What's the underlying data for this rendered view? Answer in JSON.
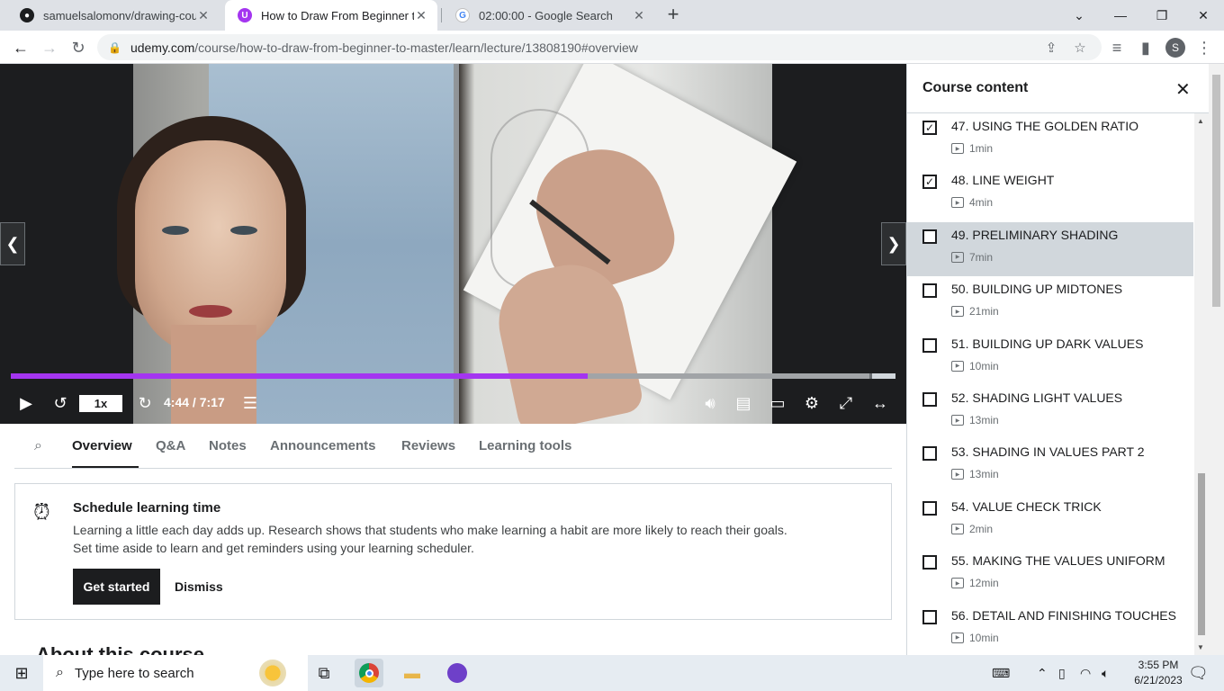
{
  "browser": {
    "tabs": [
      {
        "title": "samuelsalomonv/drawing-course",
        "icon": "github-icon"
      },
      {
        "title": "How to Draw From Beginner to M",
        "icon": "udemy-icon"
      },
      {
        "title": "02:00:00 - Google Search",
        "icon": "google-icon"
      }
    ],
    "url_host": "udemy.com",
    "url_path": "/course/how-to-draw-from-beginner-to-master/learn/lecture/13808190#overview",
    "profile_initial": "S"
  },
  "player": {
    "speed": "1x",
    "timecode": "4:44 / 7:17",
    "progress_fraction": 0.652,
    "buffered_fraction": 0.97,
    "accent": "#a435f0"
  },
  "lower_tabs": [
    "Overview",
    "Q&A",
    "Notes",
    "Announcements",
    "Reviews",
    "Learning tools"
  ],
  "schedule_card": {
    "title": "Schedule learning time",
    "line1": "Learning a little each day adds up. Research shows that students who make learning a habit are more likely to reach their goals.",
    "line2": "Set time aside to learn and get reminders using your learning scheduler.",
    "primary": "Get started",
    "secondary": "Dismiss"
  },
  "about_peek": "About this course",
  "sidebar": {
    "title": "Course content",
    "lectures": [
      {
        "title": "47. USING THE GOLDEN RATIO",
        "duration": "1min",
        "checked": true,
        "current": false
      },
      {
        "title": "48. LINE WEIGHT",
        "duration": "4min",
        "checked": true,
        "current": false
      },
      {
        "title": "49. PRELIMINARY SHADING",
        "duration": "7min",
        "checked": false,
        "current": true
      },
      {
        "title": "50. BUILDING UP MIDTONES",
        "duration": "21min",
        "checked": false,
        "current": false
      },
      {
        "title": "51. BUILDING UP DARK VALUES",
        "duration": "10min",
        "checked": false,
        "current": false
      },
      {
        "title": "52. SHADING LIGHT VALUES",
        "duration": "13min",
        "checked": false,
        "current": false
      },
      {
        "title": "53. SHADING IN VALUES PART 2",
        "duration": "13min",
        "checked": false,
        "current": false
      },
      {
        "title": "54. VALUE CHECK TRICK",
        "duration": "2min",
        "checked": false,
        "current": false
      },
      {
        "title": "55. MAKING THE VALUES UNIFORM",
        "duration": "12min",
        "checked": false,
        "current": false
      },
      {
        "title": "56. DETAIL AND FINISHING TOUCHES",
        "duration": "10min",
        "checked": false,
        "current": false
      }
    ]
  },
  "taskbar": {
    "search_placeholder": "Type here to search",
    "time": "3:55 PM",
    "date": "6/21/2023"
  }
}
